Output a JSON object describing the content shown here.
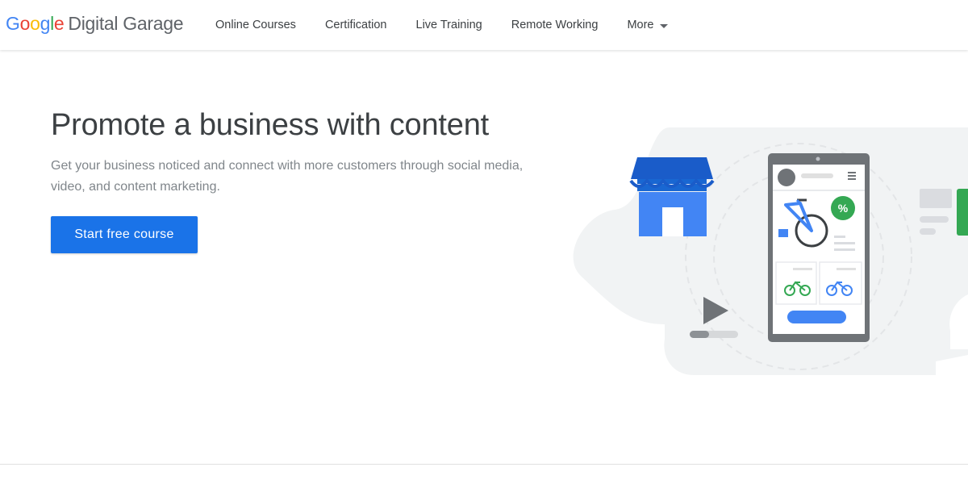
{
  "header": {
    "logo": {
      "brand_letters": [
        "G",
        "o",
        "o",
        "g",
        "l",
        "e"
      ],
      "brand_colors": [
        "#4285F4",
        "#EA4335",
        "#FBBC05",
        "#4285F4",
        "#34A853",
        "#EA4335"
      ],
      "product": "Digital Garage"
    },
    "nav": [
      {
        "label": "Online Courses"
      },
      {
        "label": "Certification"
      },
      {
        "label": "Live Training"
      },
      {
        "label": "Remote Working"
      },
      {
        "label": "More"
      }
    ]
  },
  "hero": {
    "title": "Promote a business with content",
    "description": "Get your business noticed and connect with more customers through social media, video, and content marketing.",
    "cta_label": "Start free course",
    "discount_badge": "%"
  },
  "colors": {
    "accent": "#1a73e8",
    "store_blue": "#4285F4",
    "green": "#34A853",
    "gray_bg": "#f1f3f4"
  }
}
